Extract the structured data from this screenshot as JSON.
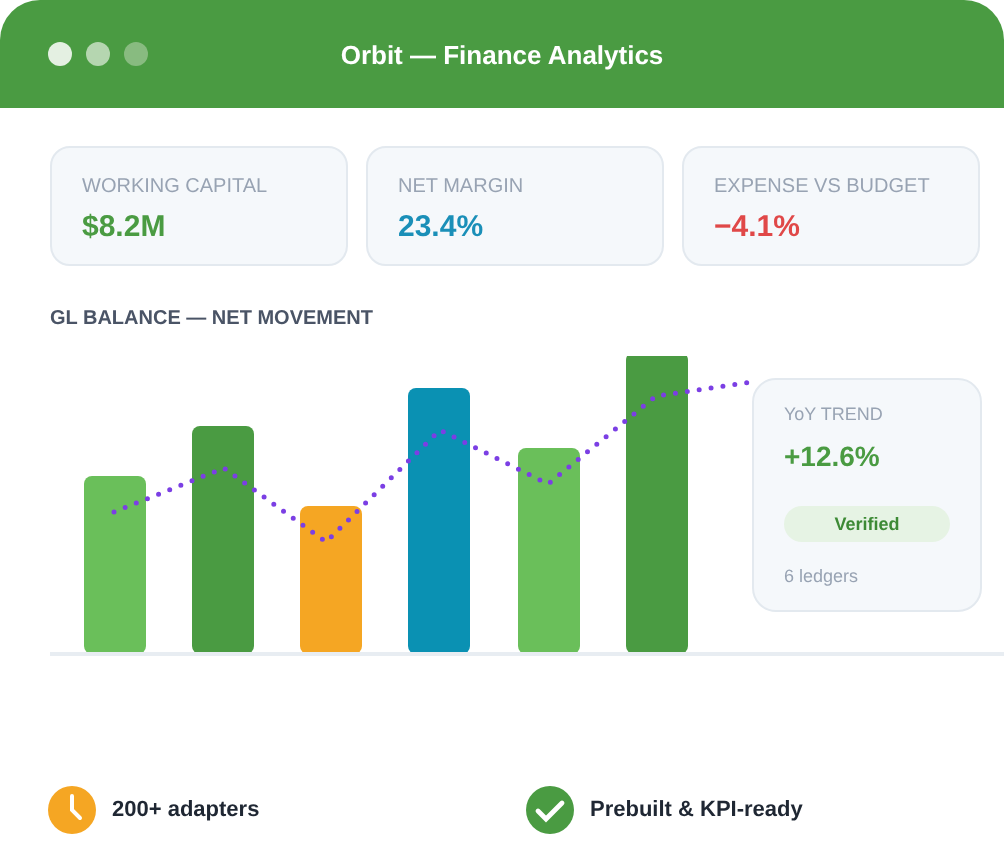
{
  "window": {
    "title": "Orbit — Finance Analytics"
  },
  "kpis": [
    {
      "label": "WORKING CAPITAL",
      "value": "$8.2M",
      "color": "#4a9b42"
    },
    {
      "label": "NET MARGIN",
      "value": "23.4%",
      "color": "#1a8fb8"
    },
    {
      "label": "EXPENSE VS BUDGET",
      "value": "−4.1%",
      "color": "#e04848"
    }
  ],
  "chart": {
    "title": "GL BALANCE — NET MOVEMENT"
  },
  "trend": {
    "label": "YoY TREND",
    "value": "+12.6%",
    "badge": "Verified",
    "note": "6 ledgers"
  },
  "features": [
    {
      "kind": "clock",
      "label": "200+ adapters"
    },
    {
      "kind": "check",
      "label": "Prebuilt & KPI-ready"
    }
  ]
}
